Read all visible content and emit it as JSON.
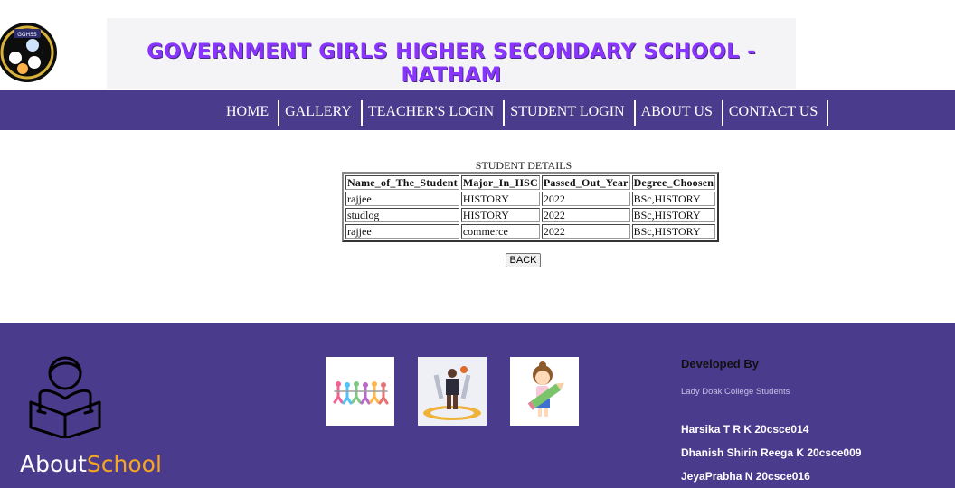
{
  "header": {
    "title": "GOVERNMENT GIRLS HIGHER SECONDARY SCHOOL - NATHAM",
    "logo_text": "GGHSS"
  },
  "nav": {
    "items": [
      {
        "label": "HOME"
      },
      {
        "label": "GALLERY"
      },
      {
        "label": "TEACHER'S LOGIN"
      },
      {
        "label": "STUDENT LOGIN"
      },
      {
        "label": "ABOUT US"
      },
      {
        "label": "CONTACT US"
      }
    ]
  },
  "main": {
    "caption": "STUDENT DETAILS",
    "columns": [
      "Name_of_The_Student",
      "Major_In_HSC",
      "Passed_Out_Year",
      "Degree_Choosen"
    ],
    "rows": [
      [
        "rajjee",
        "HISTORY",
        "2022",
        "BSc,HISTORY"
      ],
      [
        "studlog",
        "HISTORY",
        "2022",
        "BSc,HISTORY"
      ],
      [
        "rajjee",
        "commerce",
        "2022",
        "BSc,HISTORY"
      ]
    ],
    "back_label": "BACK"
  },
  "footer": {
    "brand_about": "About",
    "brand_school": "School",
    "developed_by": "Developed By",
    "college": "Lady Doak College Students",
    "developers": [
      "Harsika T R K 20csce014",
      "Dhanish Shirin Reega K 20csce009",
      "JeyaPrabha N 20csce016"
    ],
    "icons": [
      "reader-icon",
      "kids-icon",
      "basketball-player-icon",
      "girl-pencil-icon"
    ]
  },
  "colors": {
    "nav_bg": "#4a3b8c",
    "title": "#8a34ff",
    "accent_orange": "#f5a623"
  }
}
